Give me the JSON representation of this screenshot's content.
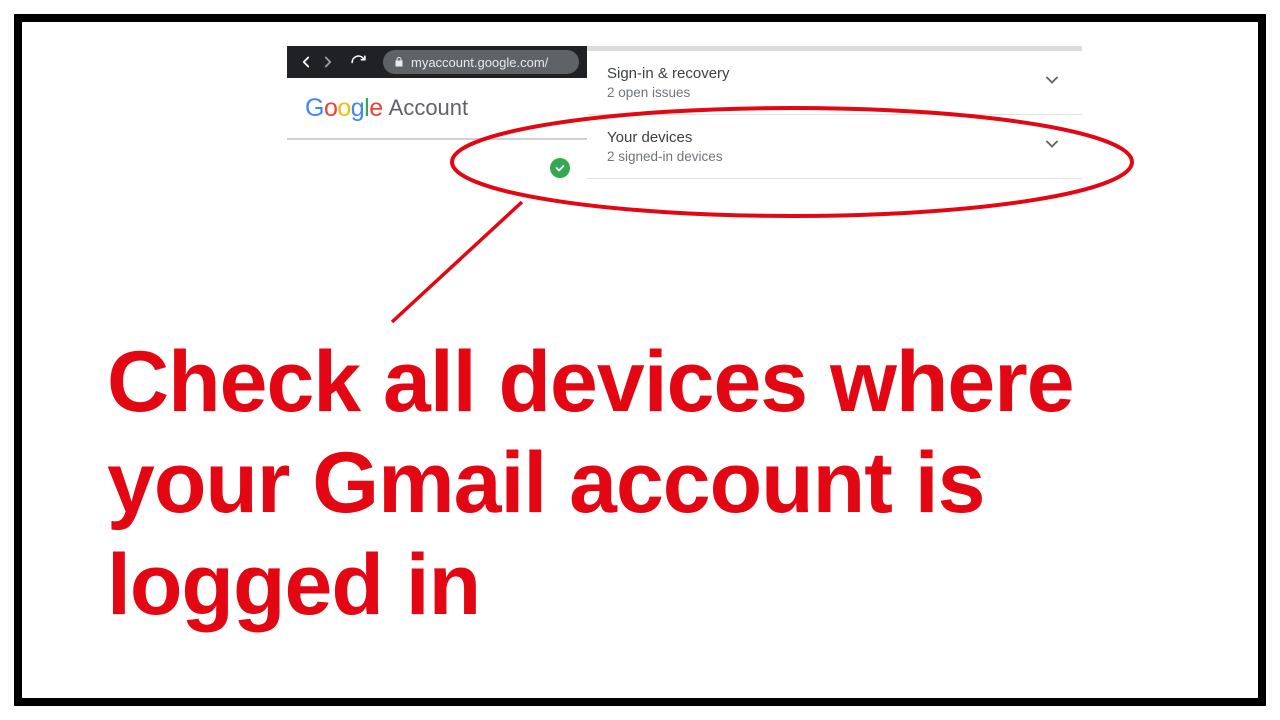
{
  "browser": {
    "url_text": "myaccount.google.com/"
  },
  "header": {
    "logo_letters": [
      "G",
      "o",
      "o",
      "g",
      "l",
      "e"
    ],
    "account_label": "Account"
  },
  "items": {
    "signin": {
      "title": "Sign-in & recovery",
      "sub": "2 open issues"
    },
    "devices": {
      "title": "Your devices",
      "sub": "2 signed-in devices"
    }
  },
  "annotation": {
    "caption": "Check all devices where your Gmail account is logged in"
  }
}
